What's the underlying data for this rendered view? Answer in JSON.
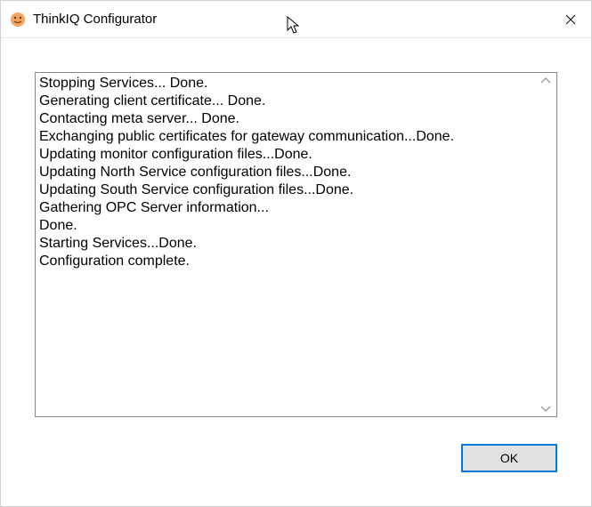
{
  "window": {
    "title": "ThinkIQ Configurator"
  },
  "log": {
    "lines": [
      "Stopping Services... Done.",
      "Generating client certificate... Done.",
      "Contacting meta server... Done.",
      "Exchanging public certificates for gateway communication...Done.",
      "Updating monitor configuration files...Done.",
      "Updating North Service configuration files...Done.",
      "Updating South Service configuration files...Done.",
      "Gathering OPC Server information...",
      "Done.",
      "Starting Services...Done.",
      "Configuration complete."
    ]
  },
  "buttons": {
    "ok": "OK"
  }
}
